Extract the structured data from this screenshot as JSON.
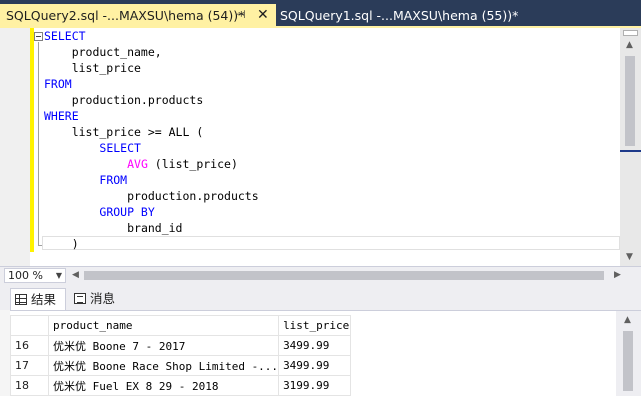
{
  "tabs": {
    "active": {
      "title": "SQLQuery2.sql -...MAXSU\\hema (54))*",
      "pin_icon": "pin-icon",
      "close_label": "✕"
    },
    "inactive": {
      "title": "SQLQuery1.sql -...MAXSU\\hema (55))*"
    }
  },
  "editor": {
    "lines": {
      "l1": "SELECT",
      "l2": "    product_name,",
      "l3": "    list_price",
      "l4": "FROM",
      "l5": "    production.products",
      "l6": "WHERE",
      "l7a": "    list_price >= ALL (",
      "l8": "SELECT",
      "l9": "AVG",
      "l9b": " (list_price)",
      "l10": "FROM",
      "l11": "production.products",
      "l12": "GROUP BY",
      "l13": "brand_id",
      "l14": ")"
    },
    "colors": {
      "keyword": "#0000ff",
      "function": "#ff00ff",
      "modified_bar": "#fff200"
    }
  },
  "zoom": {
    "value": "100 %"
  },
  "result_tabs": {
    "results": "结果",
    "messages": "消息"
  },
  "results": {
    "columns": [
      "product_name",
      "list_price"
    ],
    "rows": [
      {
        "num": "16",
        "product_name": "优米优 Boone 7 - 2017",
        "list_price": "3499.99"
      },
      {
        "num": "17",
        "product_name": "优米优 Boone Race Shop Limited -...",
        "list_price": "3499.99"
      },
      {
        "num": "18",
        "product_name": "优米优 Fuel EX 8 29 - 2018",
        "list_price": "3199.99"
      }
    ]
  },
  "theme": {
    "tab_active_bg": "#fff1a3",
    "tabstrip_bg": "#2b3c59"
  }
}
